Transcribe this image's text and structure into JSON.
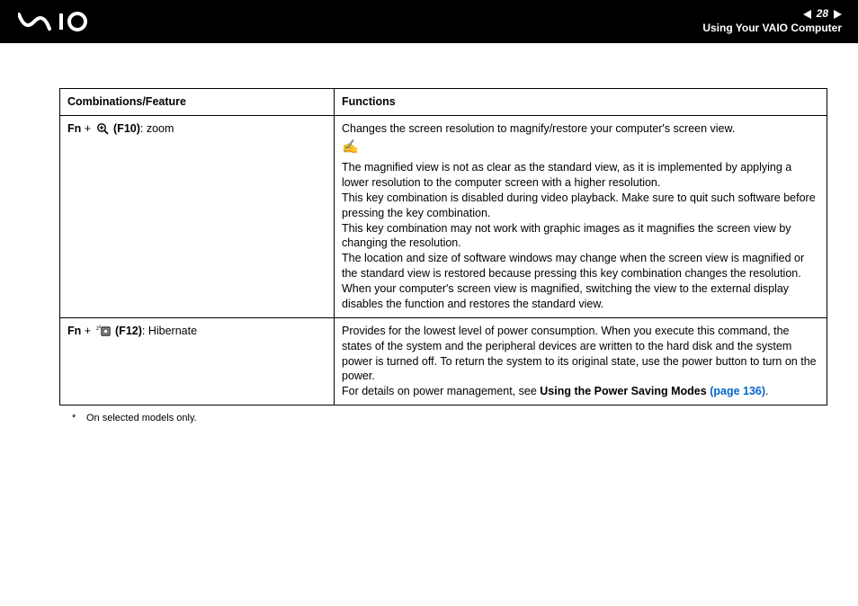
{
  "header": {
    "page_number": "28",
    "section_title": "Using Your VAIO Computer"
  },
  "table": {
    "headers": {
      "col1": "Combinations/Feature",
      "col2": "Functions"
    },
    "rows": [
      {
        "feature": {
          "prefix": "Fn",
          "plus": " + ",
          "key": "(F10)",
          "suffix": ": zoom"
        },
        "icon": "zoom-icon",
        "function_intro": "Changes the screen resolution to magnify/restore your computer's screen view.",
        "note_lines": [
          "The magnified view is not as clear as the standard view, as it is implemented by applying a lower resolution to the computer screen with a higher resolution.",
          "This key combination is disabled during video playback. Make sure to quit such software before pressing the key combination.",
          "This key combination may not work with graphic images as it magnifies the screen view by changing the resolution.",
          "The location and size of software windows may change when the screen view is magnified or the standard view is restored because pressing this key combination changes the resolution.",
          "When your computer's screen view is magnified, switching the view to the external display disables the function and restores the standard view."
        ]
      },
      {
        "feature": {
          "prefix": "Fn",
          "plus": " + ",
          "key": "(F12)",
          "suffix": ": Hibernate"
        },
        "icon": "hibernate-icon",
        "function_text": "Provides for the lowest level of power consumption. When you execute this command, the states of the system and the peripheral devices are written to the hard disk and the system power is turned off. To return the system to its original state, use the power button to turn on the power.",
        "details_prefix": "For details on power management, see ",
        "details_link_label": "Using the Power Saving Modes",
        "details_link_page": "(page 136)",
        "details_period": "."
      }
    ]
  },
  "footnote": {
    "marker": "*",
    "text": "On selected models only."
  }
}
